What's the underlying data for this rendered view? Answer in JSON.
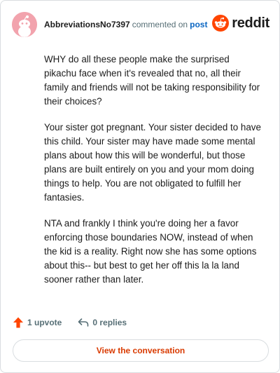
{
  "header": {
    "username": "AbbreviationsNo7397",
    "action_text": "commented on",
    "post_link": "post",
    "brand": "reddit"
  },
  "comment": {
    "paragraphs": [
      "WHY do all these people make the surprised pikachu face when it's revealed that no, all their family and friends will not be taking responsibility for their choices?",
      "Your sister got pregnant. Your sister decided to have this child. Your sister may have made some mental plans about how this will be wonderful, but those plans are built entirely on you and your mom doing things to help. You are not obligated to fulfill her fantasies.",
      "NTA and frankly I think you're doing her a favor enforcing those boundaries NOW, instead of when the kid is a reality. Right now she has some options about this-- but best to get her off this la la land sooner rather than later."
    ]
  },
  "actions": {
    "upvote_label": "1 upvote",
    "replies_label": "0 replies"
  },
  "cta": {
    "label": "View the conversation"
  },
  "colors": {
    "brand_orange": "#ff4500",
    "link_blue": "#0a66c2",
    "cta_text": "#d93a00",
    "avatar_bg": "#f2a3ad"
  },
  "icons": {
    "avatar": "snoo-avatar",
    "brand": "reddit-logo-icon",
    "upvote": "upvote-arrow-icon",
    "reply": "reply-arrow-icon"
  }
}
